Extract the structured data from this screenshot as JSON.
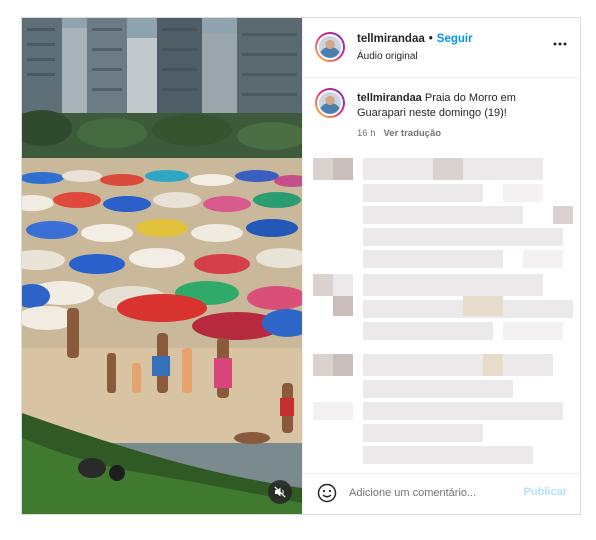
{
  "post": {
    "username": "tellmirandaa",
    "separator": "•",
    "follow_label": "Seguir",
    "audio_label": "Áudio original",
    "more_icon": "more-horizontal-icon",
    "caption_user": "tellmirandaa",
    "caption_text": "Praia do Morro em Guarapari neste domingo (19)!",
    "timestamp": "16 h",
    "translate_label": "Ver tradução",
    "comment_placeholder": "Adicione um comentário...",
    "publish_label": "Publicar",
    "mute_icon": "speaker-muted-icon",
    "emoji_icon": "smiley-face-icon"
  },
  "colors": {
    "link": "#0095f6",
    "publish_disabled": "#b2dffc",
    "muted_text": "#737373",
    "border": "#dbdbdb"
  }
}
